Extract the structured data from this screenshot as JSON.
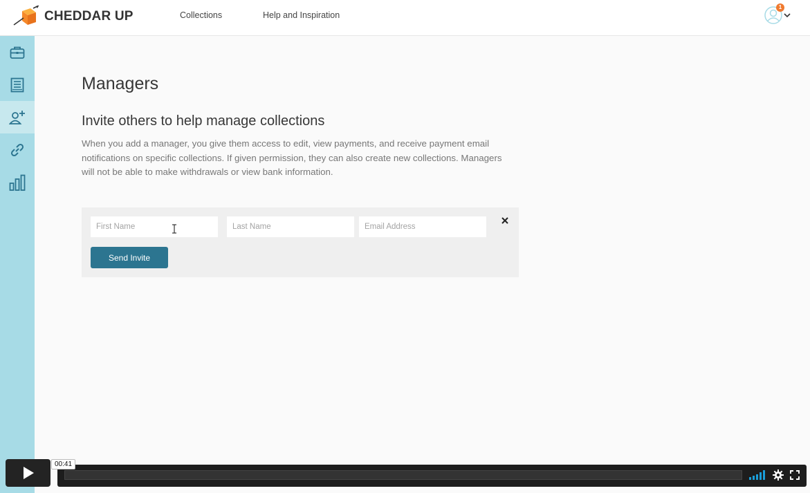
{
  "brand": {
    "name": "CHEDDAR UP"
  },
  "nav": {
    "collections": "Collections",
    "help": "Help and Inspiration"
  },
  "user": {
    "notification_count": "1"
  },
  "sidebar": {
    "items": [
      {
        "icon": "briefcase-icon",
        "active": false
      },
      {
        "icon": "ledger-icon",
        "active": false
      },
      {
        "icon": "add-user-icon",
        "active": true
      },
      {
        "icon": "link-icon",
        "active": false
      },
      {
        "icon": "bar-chart-icon",
        "active": false
      }
    ]
  },
  "page": {
    "title": "Managers",
    "subtitle": "Invite others to help manage collections",
    "description": "When you add a manager, you give them access to edit, view payments, and receive payment email notifications on specific collections. If given permission, they can also create new collections. Managers will not be able to make withdrawals or view bank information."
  },
  "invite_form": {
    "first_name_placeholder": "First Name",
    "last_name_placeholder": "Last Name",
    "email_placeholder": "Email Address",
    "first_name_value": "",
    "last_name_value": "",
    "email_value": "",
    "send_label": "Send Invite"
  },
  "video_player": {
    "timecode": "00:41",
    "progress": 0.0
  },
  "colors": {
    "accent": "#2c7590",
    "sidebar": "#a7dbe6",
    "sidebar_active": "#c7e8ee",
    "notification": "#f07a2f",
    "brand_orange": "#f5892a"
  }
}
